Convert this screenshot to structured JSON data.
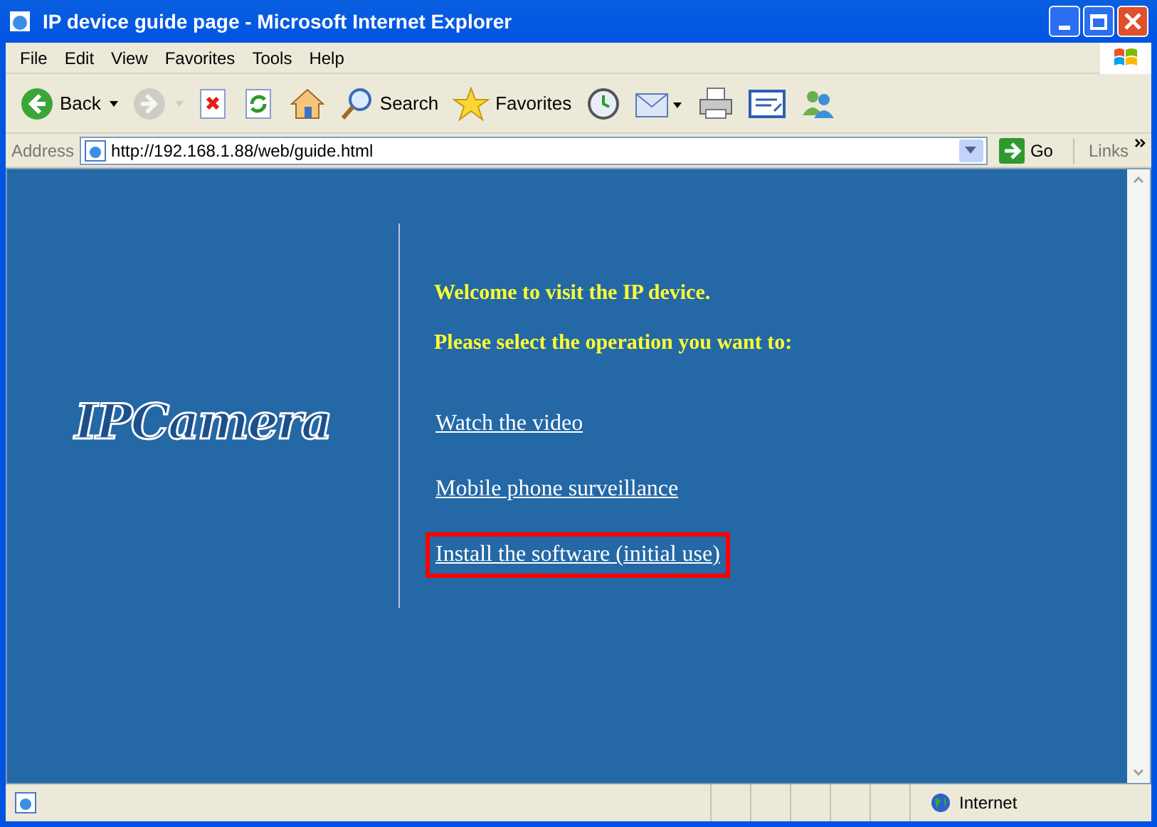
{
  "window": {
    "title": "IP device guide page - Microsoft Internet Explorer"
  },
  "menu": [
    "File",
    "Edit",
    "View",
    "Favorites",
    "Tools",
    "Help"
  ],
  "toolbar": [
    {
      "kind": "back",
      "label": "Back",
      "disabled": false
    },
    {
      "kind": "forward",
      "disabled": true
    },
    {
      "kind": "stop",
      "disabled": false
    },
    {
      "kind": "refresh",
      "disabled": false
    },
    {
      "kind": "home",
      "disabled": false
    },
    {
      "kind": "search",
      "label": "Search",
      "disabled": false
    },
    {
      "kind": "favorites",
      "label": "Favorites",
      "disabled": false
    },
    {
      "kind": "history",
      "disabled": false
    },
    {
      "kind": "mail",
      "disabled": false
    },
    {
      "kind": "print",
      "disabled": false
    },
    {
      "kind": "edit",
      "disabled": false
    },
    {
      "kind": "messenger",
      "disabled": false
    }
  ],
  "address": {
    "label": "Address",
    "value": "http://192.168.1.88/web/guide.html",
    "go": "Go",
    "links": "Links"
  },
  "page": {
    "logo": "IPCamera",
    "heading": "Welcome to visit the IP device.",
    "prompt": "Please select the operation you want to:",
    "links": [
      {
        "label": "Watch the video",
        "highlighted": false
      },
      {
        "label": "Mobile phone surveillance",
        "highlighted": false
      },
      {
        "label": "Install the software (initial use)",
        "highlighted": true
      }
    ]
  },
  "status_bar": {
    "zone": "Internet"
  }
}
